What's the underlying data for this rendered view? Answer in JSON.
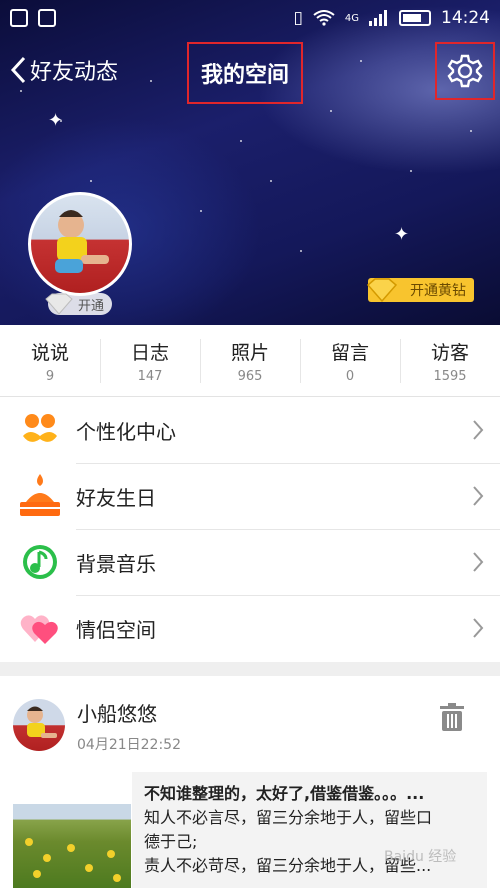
{
  "status_bar": {
    "time": "14:24",
    "network": "4G"
  },
  "header": {
    "back_label": "好友动态",
    "title": "我的空间",
    "open_badge": "开通",
    "vip_badge": "开通黄钻"
  },
  "stats": [
    {
      "label": "说说",
      "value": "9"
    },
    {
      "label": "日志",
      "value": "147"
    },
    {
      "label": "照片",
      "value": "965"
    },
    {
      "label": "留言",
      "value": "0"
    },
    {
      "label": "访客",
      "value": "1595"
    }
  ],
  "menu": [
    {
      "label": "个性化中心",
      "icon": "mustache-icon",
      "color": "#ff8a1a"
    },
    {
      "label": "好友生日",
      "icon": "cake-icon",
      "color": "#ff7a1a"
    },
    {
      "label": "背景音乐",
      "icon": "music-note-icon",
      "color": "#2bbf4a"
    },
    {
      "label": "情侣空间",
      "icon": "hearts-icon",
      "color": "#ff5b8a"
    }
  ],
  "post": {
    "author": "小船悠悠",
    "time": "04月21日22:52",
    "lines": [
      "不知谁整理的，太好了,借鉴借鉴。。。...",
      "知人不必言尽，留三分余地于人，留些口",
      "德于己;",
      "责人不必苛尽，留三分余地于人，留些..."
    ]
  },
  "watermark": "Baidu 经验",
  "colors": {
    "highlight": "#e0262b",
    "vip": "#f8c42e"
  }
}
